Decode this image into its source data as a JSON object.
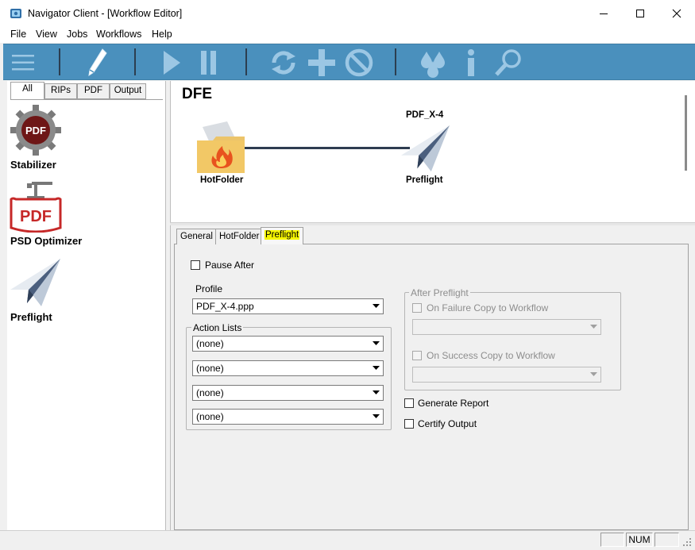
{
  "window": {
    "title": "Navigator Client - [Workflow Editor]",
    "icon": "navigator-app-icon",
    "controls": [
      "minimize-icon",
      "maximize-icon",
      "close-icon"
    ]
  },
  "menu": {
    "items": [
      "File",
      "View",
      "Jobs",
      "Workflows",
      "Help"
    ]
  },
  "toolbar": {
    "accent_color": "#4a90bd",
    "icons": [
      "hamburger-icon",
      "pencil-icon",
      "play-icon",
      "pause-icon",
      "refresh-icon",
      "plus-icon",
      "cancel-icon",
      "ink-drops-icon",
      "info-icon",
      "search-icon"
    ]
  },
  "palette": {
    "tabs": [
      "All",
      "RIPs",
      "PDF",
      "Output"
    ],
    "active_tab": "All",
    "items": [
      {
        "label": "Stabilizer",
        "icon": "pdf-gear-icon",
        "icon_text": "PDF"
      },
      {
        "label": "PSD Optimizer",
        "icon": "pdf-press-icon",
        "icon_text": "PDF"
      },
      {
        "label": "Preflight",
        "icon": "paper-plane-icon"
      }
    ]
  },
  "canvas": {
    "title": "DFE",
    "nodes": [
      {
        "label": "HotFolder",
        "icon": "hot-folder-icon",
        "caption": ""
      },
      {
        "label": "Preflight",
        "icon": "paper-plane-icon",
        "caption": "PDF_X-4"
      }
    ]
  },
  "properties": {
    "tabs": [
      "General",
      "HotFolder",
      "Preflight"
    ],
    "active_tab": "Preflight",
    "highlight_color": "#f5f500",
    "pause_after": {
      "label": "Pause After",
      "checked": false
    },
    "profile": {
      "label": "Profile",
      "value": "PDF_X-4.ppp"
    },
    "action_lists": {
      "label": "Action Lists",
      "values": [
        "(none)",
        "(none)",
        "(none)",
        "(none)"
      ]
    },
    "after_preflight": {
      "label": "After Preflight",
      "on_failure": {
        "label": "On Failure Copy to Workflow",
        "checked": false,
        "value": ""
      },
      "on_success": {
        "label": "On Success Copy to Workflow",
        "checked": false,
        "value": ""
      }
    },
    "generate_report": {
      "label": "Generate Report",
      "checked": false
    },
    "certify_output": {
      "label": "Certify Output",
      "checked": false
    }
  },
  "statusbar": {
    "cells": [
      "",
      "NUM",
      ""
    ]
  }
}
